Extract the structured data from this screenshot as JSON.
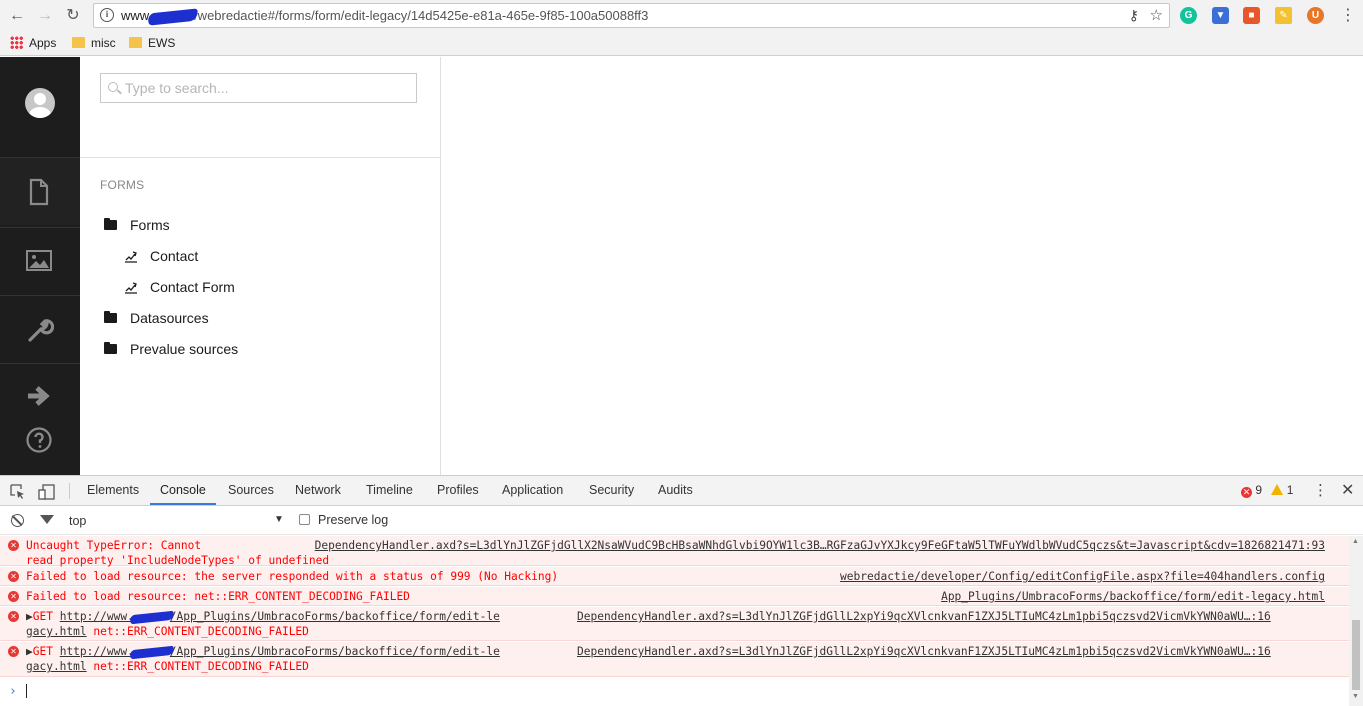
{
  "browser": {
    "url_host": "www.",
    "url_path": "/webredactie#/forms/form/edit-legacy/14d5425e-e81a-465e-9f85-100a50088ff3",
    "bookmarks": [
      {
        "label": "Apps",
        "icon": "apps-grid-icon"
      },
      {
        "label": "misc",
        "icon": "folder-icon"
      },
      {
        "label": "EWS",
        "icon": "folder-icon"
      }
    ]
  },
  "umbraco": {
    "search_placeholder": "Type to search...",
    "tree_heading": "FORMS",
    "nodes": [
      {
        "label": "Forms",
        "icon": "folder-icon"
      },
      {
        "label": "Contact",
        "icon": "form-icon"
      },
      {
        "label": "Contact Form",
        "icon": "form-icon"
      },
      {
        "label": "Datasources",
        "icon": "folder-icon"
      },
      {
        "label": "Prevalue sources",
        "icon": "folder-icon"
      }
    ],
    "sections": [
      "content-icon",
      "media-icon",
      "settings-icon",
      "exit-icon",
      "help-icon"
    ]
  },
  "devtools": {
    "tabs": [
      "Elements",
      "Console",
      "Sources",
      "Network",
      "Timeline",
      "Profiles",
      "Application",
      "Security",
      "Audits"
    ],
    "active_tab": "Console",
    "error_count": "9",
    "warning_count": "1",
    "context": "top",
    "preserve_log": "Preserve log",
    "messages": [
      {
        "line1": "Uncaught TypeError: Cannot",
        "line2": "read property 'IncludeNodeTypes' of undefined",
        "source": "DependencyHandler.axd?s=L3dlYnJlZGFjdGllX2NsaWVudC9BcHBsaWNhdGlvbi9OYW1lc3B…RGFzaGJvYXJkcy9FeGFtaW5lTWFuYWdlbWVudC5qczs&t=Javascript&cdv=1826821471:93"
      },
      {
        "text": "Failed to load resource: the server responded with a status of 999 (No Hacking)",
        "source": "webredactie/developer/Config/editConfigFile.aspx?file=404handlers.config"
      },
      {
        "text": "Failed to load resource: net::ERR_CONTENT_DECODING_FAILED",
        "source": "App_Plugins/UmbracoForms/backoffice/form/edit-legacy.html"
      },
      {
        "prefix": "GET ",
        "link_a": "http://www.",
        "link_b": "/App_Plugins/UmbracoForms/backoffice/form/edit-le",
        "link_c": "gacy.html",
        "suffix": " net::ERR_CONTENT_DECODING_FAILED",
        "source": "DependencyHandler.axd?s=L3dlYnJlZGFjdGllL2xpYi9qcXVlcnkvanF1ZXJ5LTIuMC4zLm1pbi5qczsvd2VicmVkYWN0aWU…:16"
      },
      {
        "prefix": "GET ",
        "link_a": "http://www.",
        "link_b": "/App_Plugins/UmbracoForms/backoffice/form/edit-le",
        "link_c": "gacy.html",
        "suffix": " net::ERR_CONTENT_DECODING_FAILED",
        "source": "DependencyHandler.axd?s=L3dlYnJlZGFjdGllL2xpYi9qcXVlcnkvanF1ZXJ5LTIuMC4zLm1pbi5qczsvd2VicmVkYWN0aWU…:16"
      }
    ]
  }
}
